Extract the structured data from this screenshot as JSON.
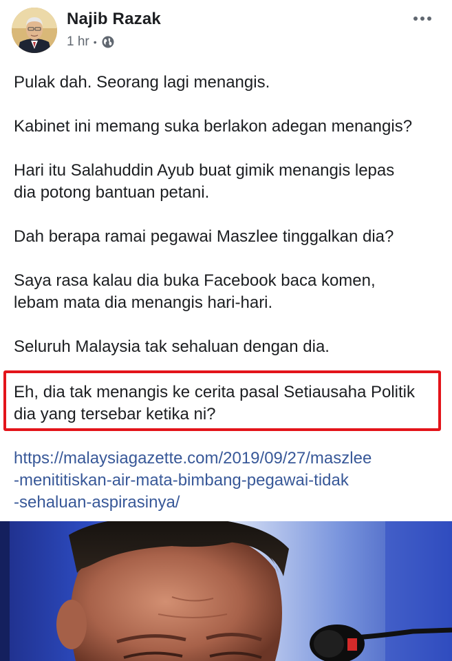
{
  "post": {
    "author": "Najib Razak",
    "time": "1 hr",
    "privacy_icon": "globe-icon",
    "more_icon": "more-options-icon",
    "paragraphs": {
      "p1": "Pulak dah. Seorang lagi menangis.",
      "p2": "Kabinet ini memang suka berlakon adegan menangis?",
      "p3": "Hari itu Salahuddin Ayub buat gimik menangis lepas\ndia potong bantuan petani.",
      "p4": "Dah berapa ramai pegawai Maszlee tinggalkan dia?",
      "p5": "Saya rasa kalau dia buka Facebook baca komen,\nlebam mata dia menangis hari-hari.",
      "p6": "Seluruh Malaysia tak sehaluan dengan dia.",
      "p7": "Eh, dia tak menangis ke cerita pasal Setiausaha Politik\ndia yang tersebar ketika ni?"
    },
    "link": "https://malaysiagazette.com/2019/09/27/maszlee\n-menititiskan-air-mata-bimbang-pegawai-tidak\n-sehaluan-aspirasinya/",
    "highlight_color": "#e3141a",
    "link_color": "#385898"
  }
}
